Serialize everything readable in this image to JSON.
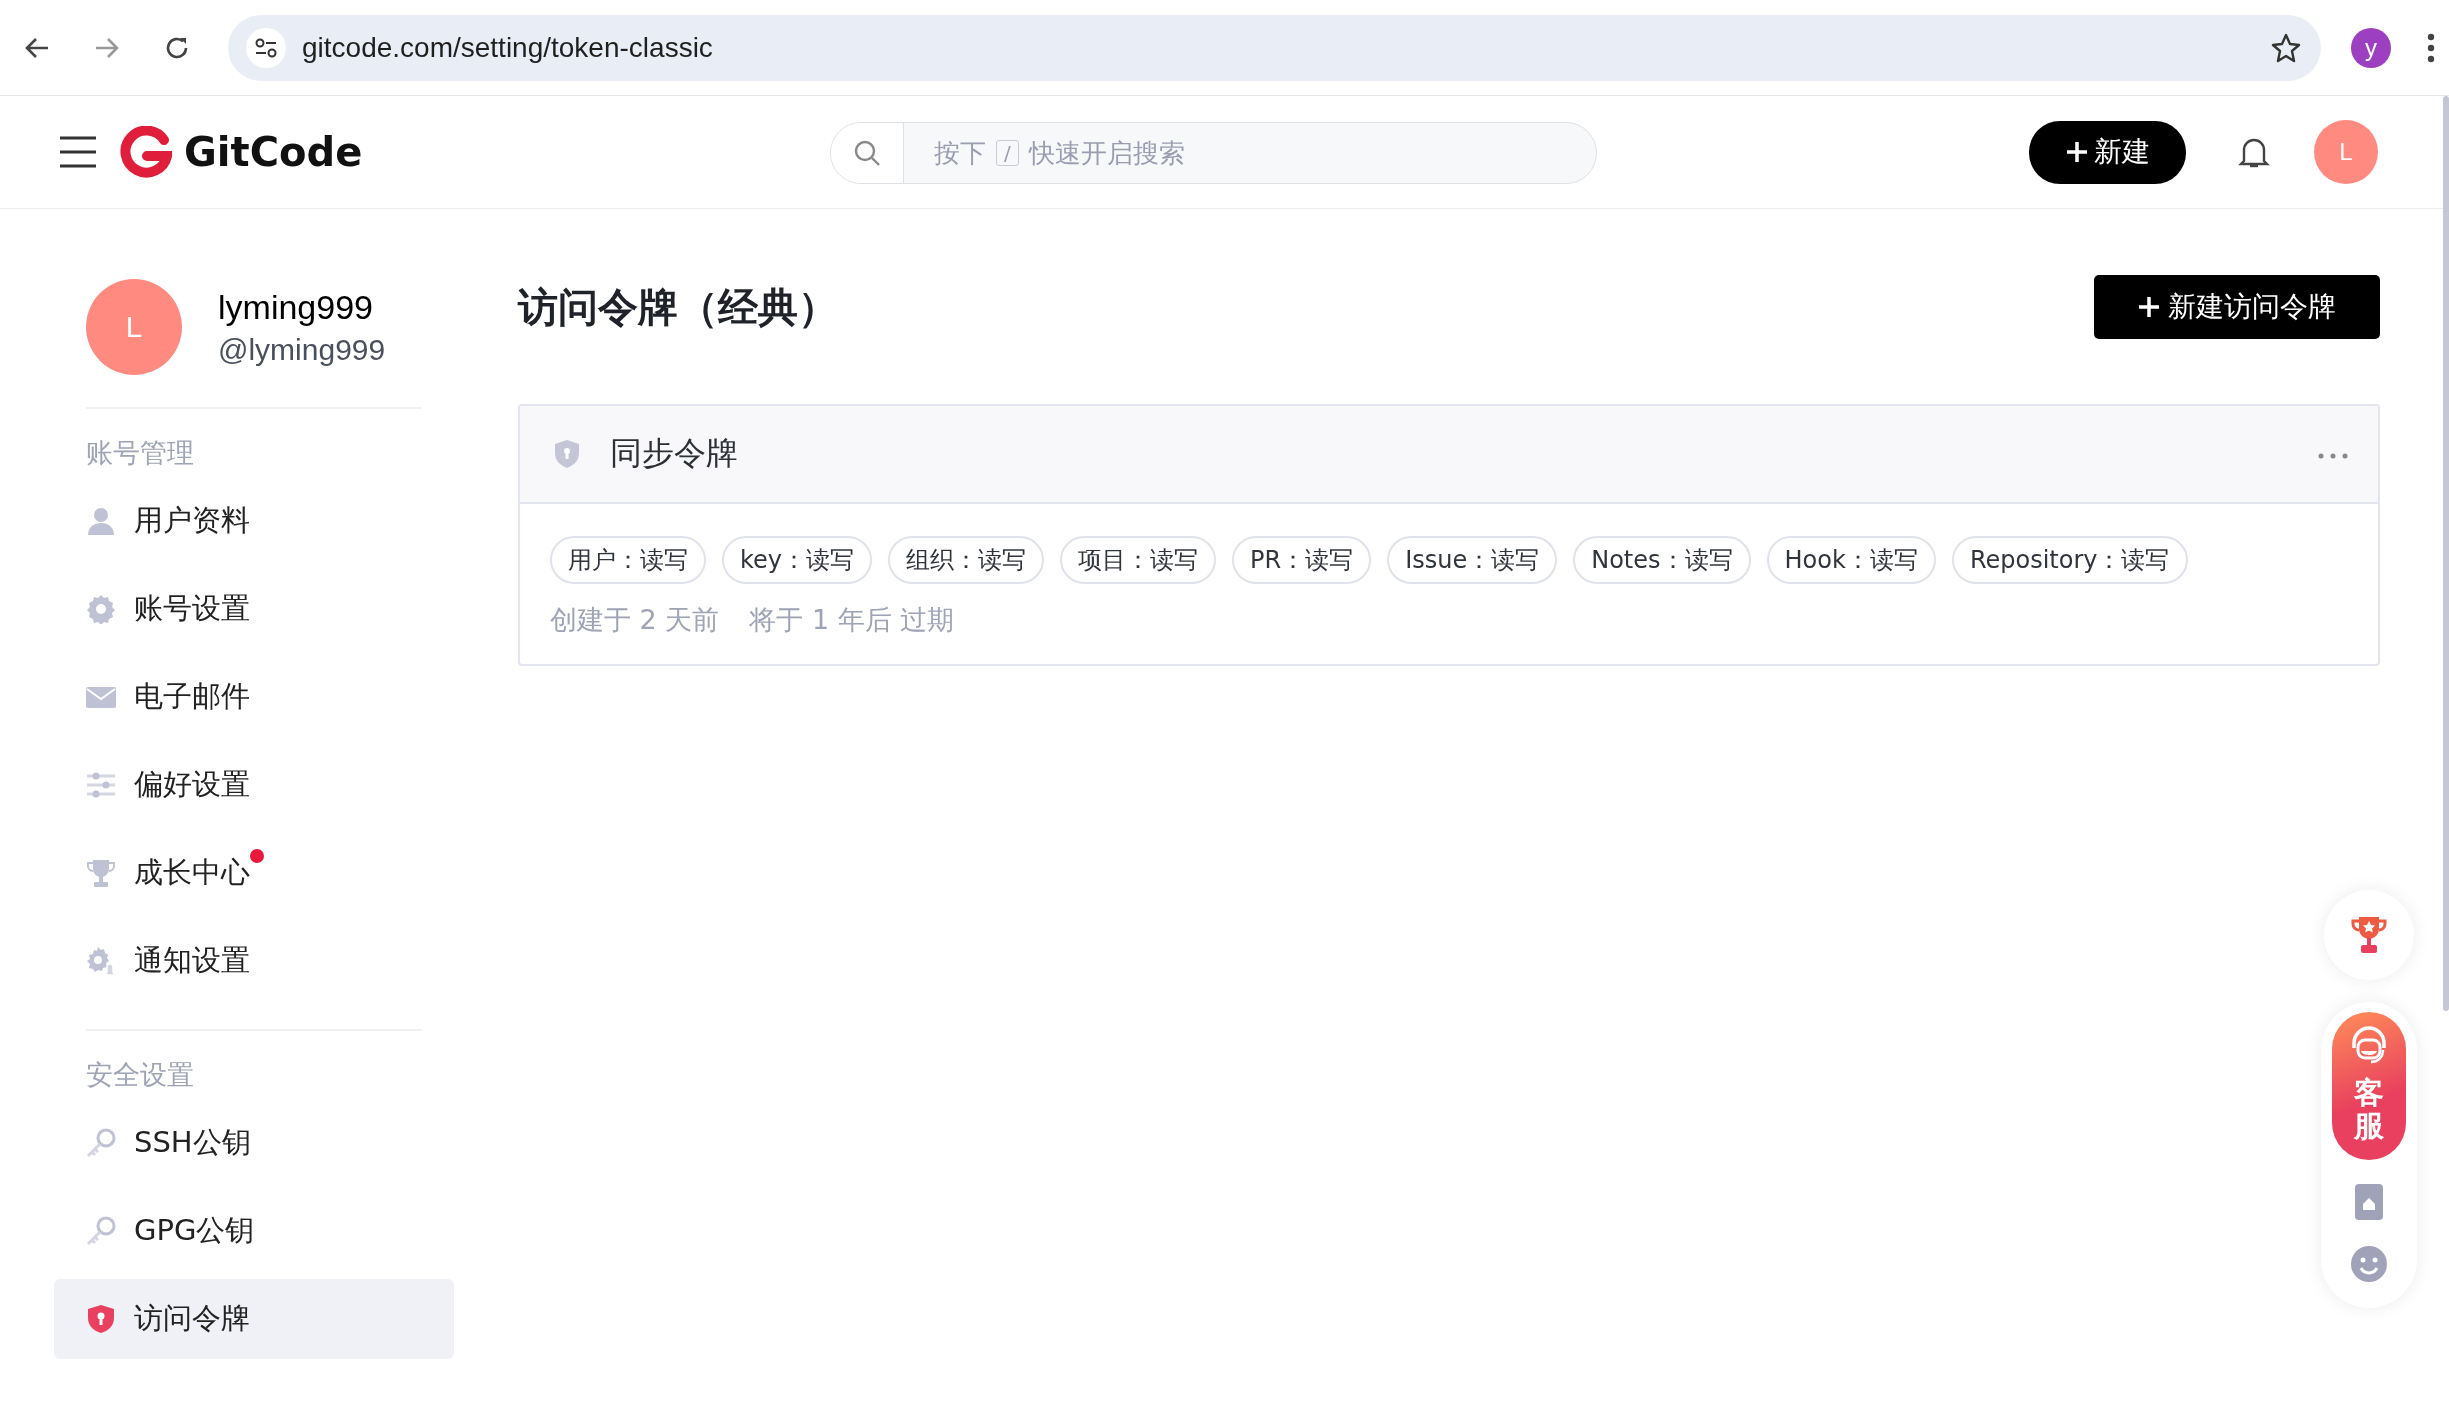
{
  "browser": {
    "url": "gitcode.com/setting/token-classic",
    "profile_initial": "y"
  },
  "header": {
    "logo": "GitCode",
    "search": {
      "hint_before": "按下",
      "shortcut_key": "/",
      "hint_after": "快速开启搜索"
    },
    "new_button": "新建",
    "avatar_initial": "L"
  },
  "sidebar": {
    "user": {
      "avatar_initial": "L",
      "name": "lyming999",
      "handle": "@lyming999"
    },
    "sections": [
      {
        "title": "账号管理",
        "items": [
          {
            "label": "用户资料",
            "selected": false,
            "badge": false
          },
          {
            "label": "账号设置",
            "selected": false,
            "badge": false
          },
          {
            "label": "电子邮件",
            "selected": false,
            "badge": false
          },
          {
            "label": "偏好设置",
            "selected": false,
            "badge": false
          },
          {
            "label": "成长中心",
            "selected": false,
            "badge": true
          },
          {
            "label": "通知设置",
            "selected": false,
            "badge": false
          }
        ]
      },
      {
        "title": "安全设置",
        "items": [
          {
            "label": "SSH公钥",
            "selected": false,
            "badge": false
          },
          {
            "label": "GPG公钥",
            "selected": false,
            "badge": false
          },
          {
            "label": "访问令牌",
            "selected": true,
            "badge": false
          }
        ]
      }
    ]
  },
  "content": {
    "title": "访问令牌（经典）",
    "new_button": "新建访问令牌",
    "tokens": [
      {
        "name": "同步令牌",
        "scopes": [
          "用户：读写",
          "key：读写",
          "组织：读写",
          "项目：读写",
          "PR：读写",
          "Issue：读写",
          "Notes：读写",
          "Hook：读写",
          "Repository：读写"
        ],
        "created": "创建于 2 天前",
        "expires": "将于 1 年后 过期"
      }
    ]
  },
  "floating": {
    "service_label": "客服"
  }
}
